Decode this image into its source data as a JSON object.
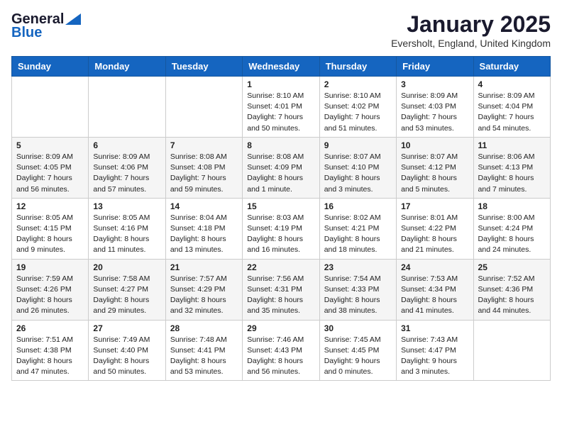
{
  "header": {
    "logo_general": "General",
    "logo_blue": "Blue",
    "month": "January 2025",
    "location": "Eversholt, England, United Kingdom"
  },
  "weekdays": [
    "Sunday",
    "Monday",
    "Tuesday",
    "Wednesday",
    "Thursday",
    "Friday",
    "Saturday"
  ],
  "weeks": [
    [
      {
        "day": "",
        "sunrise": "",
        "sunset": "",
        "daylight": ""
      },
      {
        "day": "",
        "sunrise": "",
        "sunset": "",
        "daylight": ""
      },
      {
        "day": "",
        "sunrise": "",
        "sunset": "",
        "daylight": ""
      },
      {
        "day": "1",
        "sunrise": "Sunrise: 8:10 AM",
        "sunset": "Sunset: 4:01 PM",
        "daylight": "Daylight: 7 hours and 50 minutes."
      },
      {
        "day": "2",
        "sunrise": "Sunrise: 8:10 AM",
        "sunset": "Sunset: 4:02 PM",
        "daylight": "Daylight: 7 hours and 51 minutes."
      },
      {
        "day": "3",
        "sunrise": "Sunrise: 8:09 AM",
        "sunset": "Sunset: 4:03 PM",
        "daylight": "Daylight: 7 hours and 53 minutes."
      },
      {
        "day": "4",
        "sunrise": "Sunrise: 8:09 AM",
        "sunset": "Sunset: 4:04 PM",
        "daylight": "Daylight: 7 hours and 54 minutes."
      }
    ],
    [
      {
        "day": "5",
        "sunrise": "Sunrise: 8:09 AM",
        "sunset": "Sunset: 4:05 PM",
        "daylight": "Daylight: 7 hours and 56 minutes."
      },
      {
        "day": "6",
        "sunrise": "Sunrise: 8:09 AM",
        "sunset": "Sunset: 4:06 PM",
        "daylight": "Daylight: 7 hours and 57 minutes."
      },
      {
        "day": "7",
        "sunrise": "Sunrise: 8:08 AM",
        "sunset": "Sunset: 4:08 PM",
        "daylight": "Daylight: 7 hours and 59 minutes."
      },
      {
        "day": "8",
        "sunrise": "Sunrise: 8:08 AM",
        "sunset": "Sunset: 4:09 PM",
        "daylight": "Daylight: 8 hours and 1 minute."
      },
      {
        "day": "9",
        "sunrise": "Sunrise: 8:07 AM",
        "sunset": "Sunset: 4:10 PM",
        "daylight": "Daylight: 8 hours and 3 minutes."
      },
      {
        "day": "10",
        "sunrise": "Sunrise: 8:07 AM",
        "sunset": "Sunset: 4:12 PM",
        "daylight": "Daylight: 8 hours and 5 minutes."
      },
      {
        "day": "11",
        "sunrise": "Sunrise: 8:06 AM",
        "sunset": "Sunset: 4:13 PM",
        "daylight": "Daylight: 8 hours and 7 minutes."
      }
    ],
    [
      {
        "day": "12",
        "sunrise": "Sunrise: 8:05 AM",
        "sunset": "Sunset: 4:15 PM",
        "daylight": "Daylight: 8 hours and 9 minutes."
      },
      {
        "day": "13",
        "sunrise": "Sunrise: 8:05 AM",
        "sunset": "Sunset: 4:16 PM",
        "daylight": "Daylight: 8 hours and 11 minutes."
      },
      {
        "day": "14",
        "sunrise": "Sunrise: 8:04 AM",
        "sunset": "Sunset: 4:18 PM",
        "daylight": "Daylight: 8 hours and 13 minutes."
      },
      {
        "day": "15",
        "sunrise": "Sunrise: 8:03 AM",
        "sunset": "Sunset: 4:19 PM",
        "daylight": "Daylight: 8 hours and 16 minutes."
      },
      {
        "day": "16",
        "sunrise": "Sunrise: 8:02 AM",
        "sunset": "Sunset: 4:21 PM",
        "daylight": "Daylight: 8 hours and 18 minutes."
      },
      {
        "day": "17",
        "sunrise": "Sunrise: 8:01 AM",
        "sunset": "Sunset: 4:22 PM",
        "daylight": "Daylight: 8 hours and 21 minutes."
      },
      {
        "day": "18",
        "sunrise": "Sunrise: 8:00 AM",
        "sunset": "Sunset: 4:24 PM",
        "daylight": "Daylight: 8 hours and 24 minutes."
      }
    ],
    [
      {
        "day": "19",
        "sunrise": "Sunrise: 7:59 AM",
        "sunset": "Sunset: 4:26 PM",
        "daylight": "Daylight: 8 hours and 26 minutes."
      },
      {
        "day": "20",
        "sunrise": "Sunrise: 7:58 AM",
        "sunset": "Sunset: 4:27 PM",
        "daylight": "Daylight: 8 hours and 29 minutes."
      },
      {
        "day": "21",
        "sunrise": "Sunrise: 7:57 AM",
        "sunset": "Sunset: 4:29 PM",
        "daylight": "Daylight: 8 hours and 32 minutes."
      },
      {
        "day": "22",
        "sunrise": "Sunrise: 7:56 AM",
        "sunset": "Sunset: 4:31 PM",
        "daylight": "Daylight: 8 hours and 35 minutes."
      },
      {
        "day": "23",
        "sunrise": "Sunrise: 7:54 AM",
        "sunset": "Sunset: 4:33 PM",
        "daylight": "Daylight: 8 hours and 38 minutes."
      },
      {
        "day": "24",
        "sunrise": "Sunrise: 7:53 AM",
        "sunset": "Sunset: 4:34 PM",
        "daylight": "Daylight: 8 hours and 41 minutes."
      },
      {
        "day": "25",
        "sunrise": "Sunrise: 7:52 AM",
        "sunset": "Sunset: 4:36 PM",
        "daylight": "Daylight: 8 hours and 44 minutes."
      }
    ],
    [
      {
        "day": "26",
        "sunrise": "Sunrise: 7:51 AM",
        "sunset": "Sunset: 4:38 PM",
        "daylight": "Daylight: 8 hours and 47 minutes."
      },
      {
        "day": "27",
        "sunrise": "Sunrise: 7:49 AM",
        "sunset": "Sunset: 4:40 PM",
        "daylight": "Daylight: 8 hours and 50 minutes."
      },
      {
        "day": "28",
        "sunrise": "Sunrise: 7:48 AM",
        "sunset": "Sunset: 4:41 PM",
        "daylight": "Daylight: 8 hours and 53 minutes."
      },
      {
        "day": "29",
        "sunrise": "Sunrise: 7:46 AM",
        "sunset": "Sunset: 4:43 PM",
        "daylight": "Daylight: 8 hours and 56 minutes."
      },
      {
        "day": "30",
        "sunrise": "Sunrise: 7:45 AM",
        "sunset": "Sunset: 4:45 PM",
        "daylight": "Daylight: 9 hours and 0 minutes."
      },
      {
        "day": "31",
        "sunrise": "Sunrise: 7:43 AM",
        "sunset": "Sunset: 4:47 PM",
        "daylight": "Daylight: 9 hours and 3 minutes."
      },
      {
        "day": "",
        "sunrise": "",
        "sunset": "",
        "daylight": ""
      }
    ]
  ]
}
